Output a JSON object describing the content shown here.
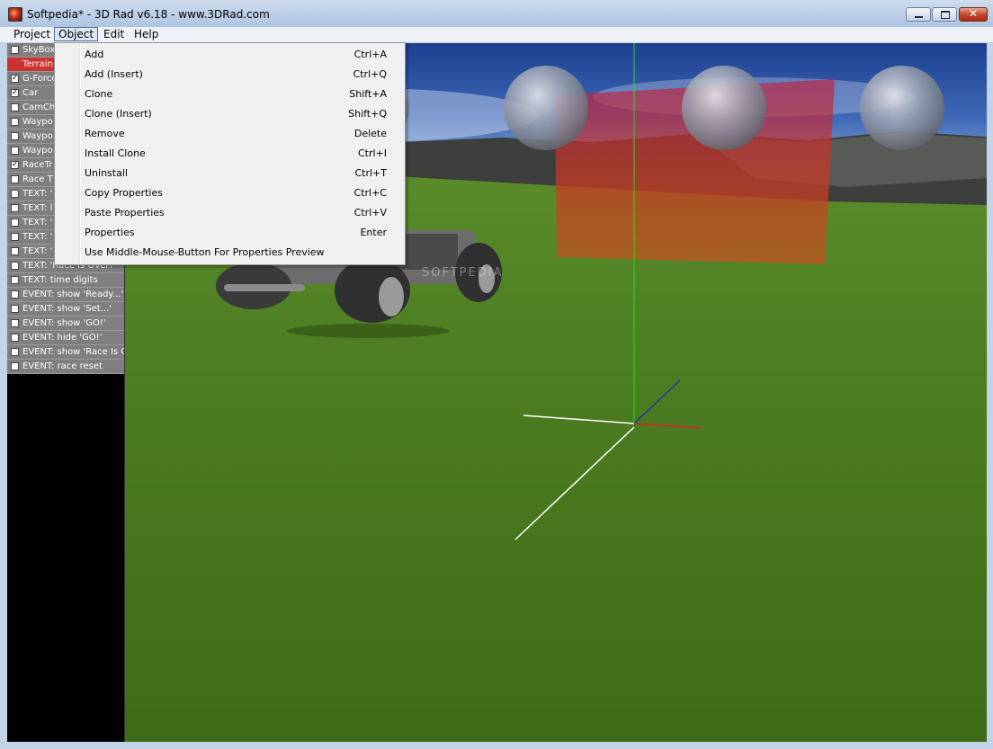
{
  "window": {
    "title": "Softpedia* - 3D Rad v6.18 - www.3DRad.com",
    "close_glyph": "✕"
  },
  "menubar": {
    "items": [
      {
        "label": "Project"
      },
      {
        "label": "Object"
      },
      {
        "label": "Edit"
      },
      {
        "label": "Help"
      }
    ]
  },
  "object_menu": {
    "items": [
      {
        "label": "Add",
        "shortcut": "Ctrl+A"
      },
      {
        "label": "Add (Insert)",
        "shortcut": "Ctrl+Q"
      },
      {
        "label": "Clone",
        "shortcut": "Shift+A"
      },
      {
        "label": "Clone (Insert)",
        "shortcut": "Shift+Q"
      },
      {
        "label": "Remove",
        "shortcut": "Delete"
      },
      {
        "label": "Install Clone",
        "shortcut": "Ctrl+I"
      },
      {
        "label": "Uninstall",
        "shortcut": "Ctrl+T"
      },
      {
        "label": "Copy Properties",
        "shortcut": "Ctrl+C"
      },
      {
        "label": "Paste Properties",
        "shortcut": "Ctrl+V"
      },
      {
        "label": "Properties",
        "shortcut": "Enter"
      },
      {
        "label": "Use Middle-Mouse-Button For Properties Preview",
        "shortcut": ""
      }
    ]
  },
  "object_list": {
    "items": [
      {
        "label": "SkyBox",
        "checked": false,
        "selected": false
      },
      {
        "label": "Terrain",
        "checked": false,
        "selected": true
      },
      {
        "label": "G-Force",
        "checked": true,
        "selected": false
      },
      {
        "label": "Car",
        "checked": true,
        "selected": false
      },
      {
        "label": "CamCh",
        "checked": false,
        "selected": false
      },
      {
        "label": "Waypo",
        "checked": false,
        "selected": false
      },
      {
        "label": "Waypo",
        "checked": false,
        "selected": false
      },
      {
        "label": "Waypo",
        "checked": false,
        "selected": false
      },
      {
        "label": "RaceTr",
        "checked": true,
        "selected": false
      },
      {
        "label": "Race T",
        "checked": false,
        "selected": false
      },
      {
        "label": "TEXT: '",
        "checked": false,
        "selected": false
      },
      {
        "label": "TEXT: l",
        "checked": false,
        "selected": false
      },
      {
        "label": "TEXT: '",
        "checked": false,
        "selected": false
      },
      {
        "label": "TEXT: '",
        "checked": false,
        "selected": false
      },
      {
        "label": "TEXT: '",
        "checked": false,
        "selected": false
      },
      {
        "label": "TEXT: 'Race Is Over!'",
        "checked": false,
        "selected": false
      },
      {
        "label": "TEXT: time digits",
        "checked": false,
        "selected": false
      },
      {
        "label": "EVENT: show 'Ready...'",
        "checked": false,
        "selected": false
      },
      {
        "label": "EVENT: show 'Set...'",
        "checked": false,
        "selected": false
      },
      {
        "label": "EVENT: show 'GO!'",
        "checked": false,
        "selected": false
      },
      {
        "label": "EVENT: hide 'GO!'",
        "checked": false,
        "selected": false
      },
      {
        "label": "EVENT: show 'Race Is Over!'",
        "checked": false,
        "selected": false
      },
      {
        "label": "EVENT: race reset",
        "checked": false,
        "selected": false
      }
    ]
  },
  "viewport": {
    "watermark": "SOFTPEDIA",
    "colors": {
      "sky": "#2a4f9a",
      "grass": "#4a7a1e",
      "axis_green": "#22dd22",
      "axis_red": "#dd2222",
      "axis_blue": "#2233aa",
      "race_zone": "#cc2233"
    }
  }
}
